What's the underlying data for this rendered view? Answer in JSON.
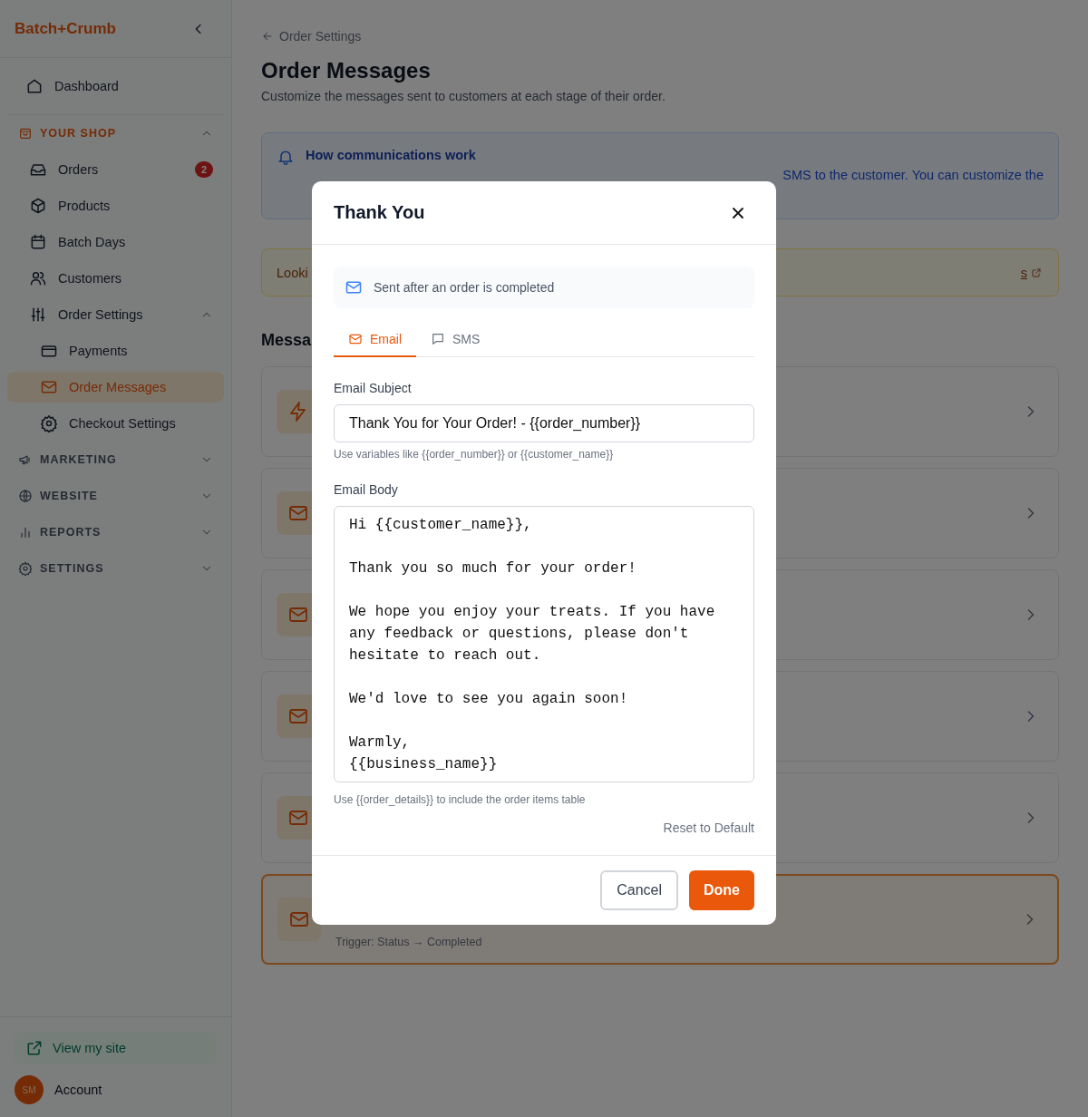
{
  "sidebar": {
    "brand": "Batch+Crumb",
    "nav": [
      {
        "kind": "item",
        "label": "Dashboard",
        "selected": false
      },
      {
        "kind": "section",
        "label": "YOUR SHOP",
        "expanded": true,
        "children": [
          {
            "label": "Orders",
            "badge": "2",
            "selected": false
          },
          {
            "label": "Products",
            "selected": false
          },
          {
            "label": "Batch Days",
            "selected": false
          },
          {
            "label": "Customers",
            "selected": false
          },
          {
            "label": "Order Settings",
            "selected": false,
            "expanded": true,
            "children": [
              {
                "label": "Payments",
                "selected": false
              },
              {
                "label": "Order Messages",
                "selected": true
              },
              {
                "label": "Checkout Settings",
                "selected": false
              }
            ]
          }
        ]
      },
      {
        "kind": "section",
        "label": "MARKETING",
        "expanded": false
      },
      {
        "kind": "section",
        "label": "WEBSITE",
        "expanded": false
      },
      {
        "kind": "section",
        "label": "REPORTS",
        "expanded": false
      },
      {
        "kind": "section",
        "label": "SETTINGS",
        "expanded": false
      }
    ],
    "view_site": "View my site",
    "account": {
      "initials": "SM",
      "label": "Account"
    }
  },
  "page": {
    "back": "Order Settings",
    "title": "Order Messages",
    "subtitle": "Customize the messages sent to customers at each stage of their order.",
    "info": {
      "title": "How communications work",
      "text_visible": "SMS to the customer. You can customize the"
    },
    "notice": {
      "text_visible": "Looki",
      "link_visible": "s"
    },
    "section_title_visible": "Messa",
    "cards": [
      {
        "kind": "lightning",
        "highlighted": false
      },
      {
        "kind": "mail",
        "highlighted": false
      },
      {
        "kind": "mail",
        "highlighted": false
      },
      {
        "kind": "mail",
        "highlighted": false
      },
      {
        "kind": "mail",
        "highlighted": false
      },
      {
        "kind": "mail",
        "highlighted": true,
        "trigger": "Trigger: Status → Completed"
      }
    ]
  },
  "modal": {
    "title": "Thank You",
    "banner": "Sent after an order is completed",
    "tabs": [
      {
        "label": "Email",
        "selected": true
      },
      {
        "label": "SMS",
        "selected": false
      }
    ],
    "subject_label": "Email Subject",
    "subject": "Thank You for Your Order! - {{order_number}}",
    "subject_hint": "Use variables like {{order_number}} or {{customer_name}}",
    "body_label": "Email Body",
    "body": "Hi {{customer_name}},\n\nThank you so much for your order!\n\nWe hope you enjoy your treats. If you have any feedback or questions, please don't hesitate to reach out.\n\nWe'd love to see you again soon!\n\nWarmly,\n{{business_name}}",
    "body_hint": "Use {{order_details}} to include the order items table",
    "reset": "Reset to Default",
    "cancel": "Cancel",
    "done": "Done"
  }
}
